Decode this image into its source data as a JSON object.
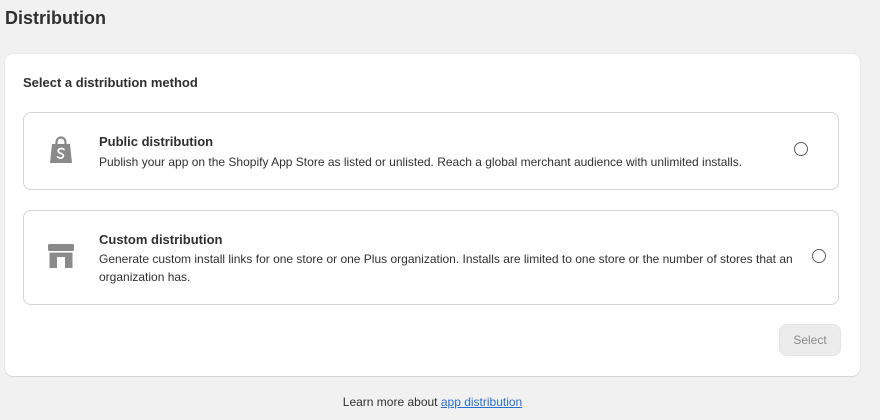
{
  "page": {
    "title": "Distribution"
  },
  "card": {
    "heading": "Select a distribution method",
    "options": [
      {
        "icon": "shopping-bag-icon",
        "title": "Public distribution",
        "description": "Publish your app on the Shopify App Store as listed or unlisted. Reach a global merchant audience with unlimited installs.",
        "selected": false
      },
      {
        "icon": "store-icon",
        "title": "Custom distribution",
        "description": "Generate custom install links for one store or one Plus organization. Installs are limited to one store or the number of stores that an organization has.",
        "selected": false
      }
    ],
    "select_button": {
      "label": "Select",
      "disabled": true
    }
  },
  "footer": {
    "text": "Learn more about",
    "link_label": "app distribution"
  },
  "colors": {
    "background": "#f1f1f1",
    "card": "#ffffff",
    "text": "#303030",
    "link": "#2c6ecb",
    "icon": "#8a8a8a",
    "button_disabled_bg": "#ececec",
    "button_disabled_text": "#8a8a8a"
  }
}
